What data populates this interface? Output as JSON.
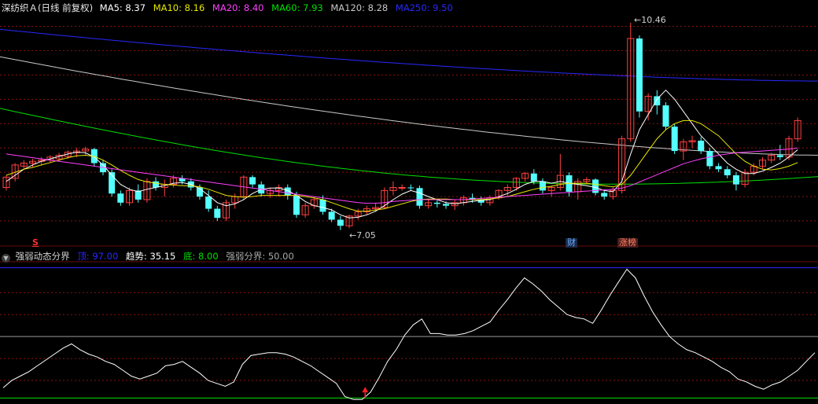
{
  "colors": {
    "up": "#ff4040",
    "down": "#54ffff",
    "ma5": "#ffffff",
    "ma10": "#e8e800",
    "ma20": "#ff40ff",
    "ma60": "#00e000",
    "ma120": "#c8c8c8",
    "ma250": "#2828ff",
    "grid": "#8b1010",
    "osc": "#ffffff"
  },
  "main_header": {
    "title": "深纺织Ａ(日线 前复权)",
    "ma5": "MA5: 8.37",
    "ma10": "MA10: 8.16",
    "ma20": "MA20: 8.40",
    "ma60": "MA60: 7.93",
    "ma120": "MA120: 8.28",
    "ma250": "MA250: 9.50"
  },
  "annotations": {
    "high_label": "10.46",
    "low_label": "7.05",
    "s_mark": "S",
    "cai_mark": "财",
    "zhangbang_mark": "涨榜"
  },
  "sub_header": {
    "title": "强弱动态分界",
    "ding": "顶: 97.00",
    "qushi": "趋势: 35.15",
    "di": "底: 8.00",
    "fenjie": "强弱分界: 50.00"
  },
  "chart_data": [
    {
      "type": "candlestick",
      "title": "深纺织Ａ(日线 前复权)",
      "y_range": [
        6.8,
        10.6
      ],
      "high": 10.46,
      "low": 7.05,
      "candles": [
        [
          7.75,
          7.95,
          7.7,
          7.92
        ],
        [
          7.9,
          8.15,
          7.85,
          8.12
        ],
        [
          8.1,
          8.2,
          8.05,
          8.15
        ],
        [
          8.15,
          8.22,
          8.08,
          8.18
        ],
        [
          8.18,
          8.25,
          8.12,
          8.2
        ],
        [
          8.2,
          8.28,
          8.15,
          8.25
        ],
        [
          8.22,
          8.32,
          8.18,
          8.28
        ],
        [
          8.26,
          8.36,
          8.22,
          8.33
        ],
        [
          8.32,
          8.4,
          8.25,
          8.35
        ],
        [
          8.35,
          8.42,
          8.28,
          8.38
        ],
        [
          8.38,
          8.4,
          8.1,
          8.15
        ],
        [
          8.15,
          8.2,
          7.95,
          8.0
        ],
        [
          8.0,
          8.05,
          7.6,
          7.65
        ],
        [
          7.65,
          7.7,
          7.45,
          7.5
        ],
        [
          7.5,
          7.75,
          7.45,
          7.7
        ],
        [
          7.7,
          7.8,
          7.5,
          7.55
        ],
        [
          7.55,
          7.9,
          7.5,
          7.85
        ],
        [
          7.85,
          7.92,
          7.7,
          7.75
        ],
        [
          7.75,
          7.88,
          7.6,
          7.8
        ],
        [
          7.8,
          7.95,
          7.75,
          7.9
        ],
        [
          7.9,
          7.95,
          7.8,
          7.85
        ],
        [
          7.85,
          7.9,
          7.7,
          7.75
        ],
        [
          7.75,
          7.8,
          7.55,
          7.6
        ],
        [
          7.6,
          7.7,
          7.35,
          7.4
        ],
        [
          7.4,
          7.45,
          7.2,
          7.25
        ],
        [
          7.25,
          7.55,
          7.2,
          7.5
        ],
        [
          7.5,
          7.65,
          7.4,
          7.6
        ],
        [
          7.6,
          7.95,
          7.55,
          7.92
        ],
        [
          7.92,
          7.95,
          7.75,
          7.8
        ],
        [
          7.8,
          7.85,
          7.6,
          7.65
        ],
        [
          7.65,
          7.75,
          7.58,
          7.7
        ],
        [
          7.7,
          7.8,
          7.6,
          7.75
        ],
        [
          7.75,
          7.8,
          7.55,
          7.62
        ],
        [
          7.62,
          7.68,
          7.25,
          7.3
        ],
        [
          7.3,
          7.5,
          7.25,
          7.45
        ],
        [
          7.45,
          7.6,
          7.4,
          7.55
        ],
        [
          7.55,
          7.62,
          7.3,
          7.35
        ],
        [
          7.35,
          7.4,
          7.18,
          7.22
        ],
        [
          7.22,
          7.28,
          7.05,
          7.12
        ],
        [
          7.12,
          7.3,
          7.08,
          7.28
        ],
        [
          7.28,
          7.4,
          7.22,
          7.35
        ],
        [
          7.35,
          7.45,
          7.3,
          7.4
        ],
        [
          7.4,
          7.5,
          7.35,
          7.42
        ],
        [
          7.42,
          7.75,
          7.4,
          7.7
        ],
        [
          7.7,
          7.85,
          7.62,
          7.75
        ],
        [
          7.75,
          7.8,
          7.7,
          7.75
        ],
        [
          7.75,
          7.8,
          7.7,
          7.74
        ],
        [
          7.74,
          7.78,
          7.4,
          7.45
        ],
        [
          7.45,
          7.55,
          7.4,
          7.5
        ],
        [
          7.5,
          7.55,
          7.42,
          7.48
        ],
        [
          7.48,
          7.52,
          7.4,
          7.45
        ],
        [
          7.45,
          7.55,
          7.38,
          7.5
        ],
        [
          7.5,
          7.62,
          7.45,
          7.58
        ],
        [
          7.58,
          7.65,
          7.5,
          7.55
        ],
        [
          7.55,
          7.6,
          7.45,
          7.5
        ],
        [
          7.5,
          7.62,
          7.45,
          7.58
        ],
        [
          7.58,
          7.72,
          7.55,
          7.7
        ],
        [
          7.7,
          7.8,
          7.6,
          7.75
        ],
        [
          7.75,
          7.92,
          7.7,
          7.9
        ],
        [
          7.9,
          8.0,
          7.85,
          7.98
        ],
        [
          7.98,
          8.05,
          7.8,
          7.85
        ],
        [
          7.85,
          7.9,
          7.65,
          7.7
        ],
        [
          7.7,
          7.78,
          7.6,
          7.75
        ],
        [
          7.75,
          8.3,
          7.7,
          7.95
        ],
        [
          7.95,
          8.0,
          7.6,
          7.68
        ],
        [
          7.68,
          7.9,
          7.55,
          7.85
        ],
        [
          7.85,
          7.92,
          7.8,
          7.88
        ],
        [
          7.88,
          7.9,
          7.62,
          7.66
        ],
        [
          7.66,
          7.72,
          7.55,
          7.6
        ],
        [
          7.6,
          7.75,
          7.55,
          7.7
        ],
        [
          7.7,
          8.6,
          7.65,
          8.55
        ],
        [
          8.55,
          10.46,
          8.5,
          10.2
        ],
        [
          10.2,
          10.25,
          8.9,
          9.0
        ],
        [
          9.0,
          9.3,
          8.85,
          9.25
        ],
        [
          9.25,
          9.35,
          8.95,
          9.1
        ],
        [
          9.1,
          9.15,
          8.7,
          8.75
        ],
        [
          8.75,
          8.8,
          8.3,
          8.35
        ],
        [
          8.35,
          8.55,
          8.2,
          8.5
        ],
        [
          8.5,
          8.6,
          8.4,
          8.52
        ],
        [
          8.52,
          8.58,
          8.3,
          8.35
        ],
        [
          8.35,
          8.4,
          8.05,
          8.1
        ],
        [
          8.1,
          8.15,
          8.0,
          8.05
        ],
        [
          8.05,
          8.1,
          7.9,
          7.95
        ],
        [
          7.95,
          8.0,
          7.7,
          7.8
        ],
        [
          7.8,
          8.05,
          7.75,
          8.0
        ],
        [
          8.0,
          8.15,
          7.95,
          8.1
        ],
        [
          8.1,
          8.25,
          8.05,
          8.2
        ],
        [
          8.2,
          8.32,
          8.15,
          8.28
        ],
        [
          8.28,
          8.45,
          8.2,
          8.25
        ],
        [
          8.25,
          8.6,
          8.2,
          8.55
        ],
        [
          8.55,
          8.9,
          8.5,
          8.85
        ]
      ],
      "ma_lines": {
        "MA5": [
          7.85,
          7.95,
          8.05,
          8.12,
          8.18,
          8.22,
          8.26,
          8.3,
          8.33,
          8.32,
          8.25,
          8.12,
          7.95,
          7.8,
          7.72,
          7.68,
          7.72,
          7.75,
          7.78,
          7.82,
          7.83,
          7.8,
          7.73,
          7.62,
          7.5,
          7.45,
          7.48,
          7.55,
          7.65,
          7.72,
          7.74,
          7.74,
          7.7,
          7.62,
          7.52,
          7.45,
          7.42,
          7.38,
          7.3,
          7.25,
          7.26,
          7.3,
          7.36,
          7.45,
          7.55,
          7.64,
          7.7,
          7.66,
          7.6,
          7.55,
          7.5,
          7.48,
          7.5,
          7.52,
          7.54,
          7.55,
          7.6,
          7.65,
          7.72,
          7.8,
          7.85,
          7.85,
          7.82,
          7.85,
          7.82,
          7.8,
          7.78,
          7.75,
          7.7,
          7.68,
          7.85,
          8.3,
          8.7,
          8.95,
          9.2,
          9.35,
          9.2,
          9.0,
          8.8,
          8.6,
          8.45,
          8.3,
          8.15,
          8.05,
          7.98,
          7.98,
          8.02,
          8.08,
          8.15,
          8.25,
          8.37
        ],
        "MA10": [
          7.95,
          8.0,
          8.05,
          8.08,
          8.12,
          8.16,
          8.2,
          8.24,
          8.27,
          8.28,
          8.26,
          8.2,
          8.12,
          8.03,
          7.95,
          7.88,
          7.84,
          7.82,
          7.8,
          7.79,
          7.78,
          7.78,
          7.76,
          7.72,
          7.67,
          7.62,
          7.6,
          7.59,
          7.6,
          7.62,
          7.62,
          7.62,
          7.62,
          7.62,
          7.6,
          7.58,
          7.55,
          7.5,
          7.45,
          7.4,
          7.36,
          7.36,
          7.38,
          7.4,
          7.44,
          7.48,
          7.52,
          7.55,
          7.56,
          7.56,
          7.56,
          7.55,
          7.55,
          7.55,
          7.55,
          7.56,
          7.58,
          7.6,
          7.64,
          7.68,
          7.72,
          7.75,
          7.77,
          7.8,
          7.82,
          7.82,
          7.82,
          7.8,
          7.78,
          7.76,
          7.8,
          7.95,
          8.15,
          8.35,
          8.55,
          8.7,
          8.8,
          8.85,
          8.85,
          8.8,
          8.7,
          8.6,
          8.45,
          8.3,
          8.18,
          8.1,
          8.05,
          8.04,
          8.06,
          8.1,
          8.16
        ],
        "MA20": [
          8.3,
          8.28,
          8.26,
          8.24,
          8.22,
          8.2,
          8.18,
          8.16,
          8.14,
          8.12,
          8.1,
          8.08,
          8.06,
          8.04,
          8.02,
          8.0,
          7.98,
          7.96,
          7.94,
          7.92,
          7.9,
          7.88,
          7.86,
          7.84,
          7.82,
          7.8,
          7.78,
          7.76,
          7.74,
          7.72,
          7.7,
          7.68,
          7.66,
          7.64,
          7.62,
          7.6,
          7.58,
          7.56,
          7.54,
          7.52,
          7.5,
          7.49,
          7.49,
          7.5,
          7.52,
          7.53,
          7.54,
          7.55,
          7.55,
          7.55,
          7.55,
          7.55,
          7.55,
          7.56,
          7.57,
          7.58,
          7.59,
          7.6,
          7.61,
          7.62,
          7.63,
          7.64,
          7.65,
          7.66,
          7.67,
          7.68,
          7.69,
          7.7,
          7.71,
          7.72,
          7.74,
          7.78,
          7.84,
          7.9,
          7.96,
          8.02,
          8.08,
          8.14,
          8.18,
          8.22,
          8.25,
          8.28,
          8.3,
          8.32,
          8.33,
          8.34,
          8.35,
          8.36,
          8.37,
          8.38,
          8.4
        ]
      },
      "long_ma": {
        "MA60": [
          9.05,
          7.93
        ],
        "MA120": [
          9.9,
          8.28
        ],
        "MA250": [
          10.35,
          9.5
        ]
      }
    },
    {
      "type": "line",
      "title": "强弱动态分界",
      "y_range": [
        5,
        100
      ],
      "ref_lines": {
        "top": 97,
        "mid": 50,
        "bottom": 8
      },
      "values": [
        15,
        20,
        23,
        26,
        30,
        34,
        38,
        42,
        45,
        41,
        38,
        36,
        33,
        31,
        27,
        23,
        21,
        23,
        25,
        30,
        31,
        33,
        29,
        25,
        20,
        18,
        16,
        19,
        31,
        37,
        38,
        39,
        39,
        38,
        36,
        33,
        30,
        26,
        22,
        18,
        9,
        7,
        7,
        12,
        22,
        33,
        41,
        51,
        58,
        62,
        52,
        52,
        51,
        51,
        52,
        54,
        57,
        60,
        68,
        75,
        83,
        90,
        86,
        81,
        75,
        70,
        65,
        63,
        62,
        59,
        68,
        78,
        87,
        96,
        90,
        78,
        67,
        58,
        50,
        45,
        41,
        39,
        36,
        33,
        29,
        26,
        21,
        19,
        16,
        14,
        17,
        19,
        23,
        27,
        33,
        39
      ]
    }
  ]
}
